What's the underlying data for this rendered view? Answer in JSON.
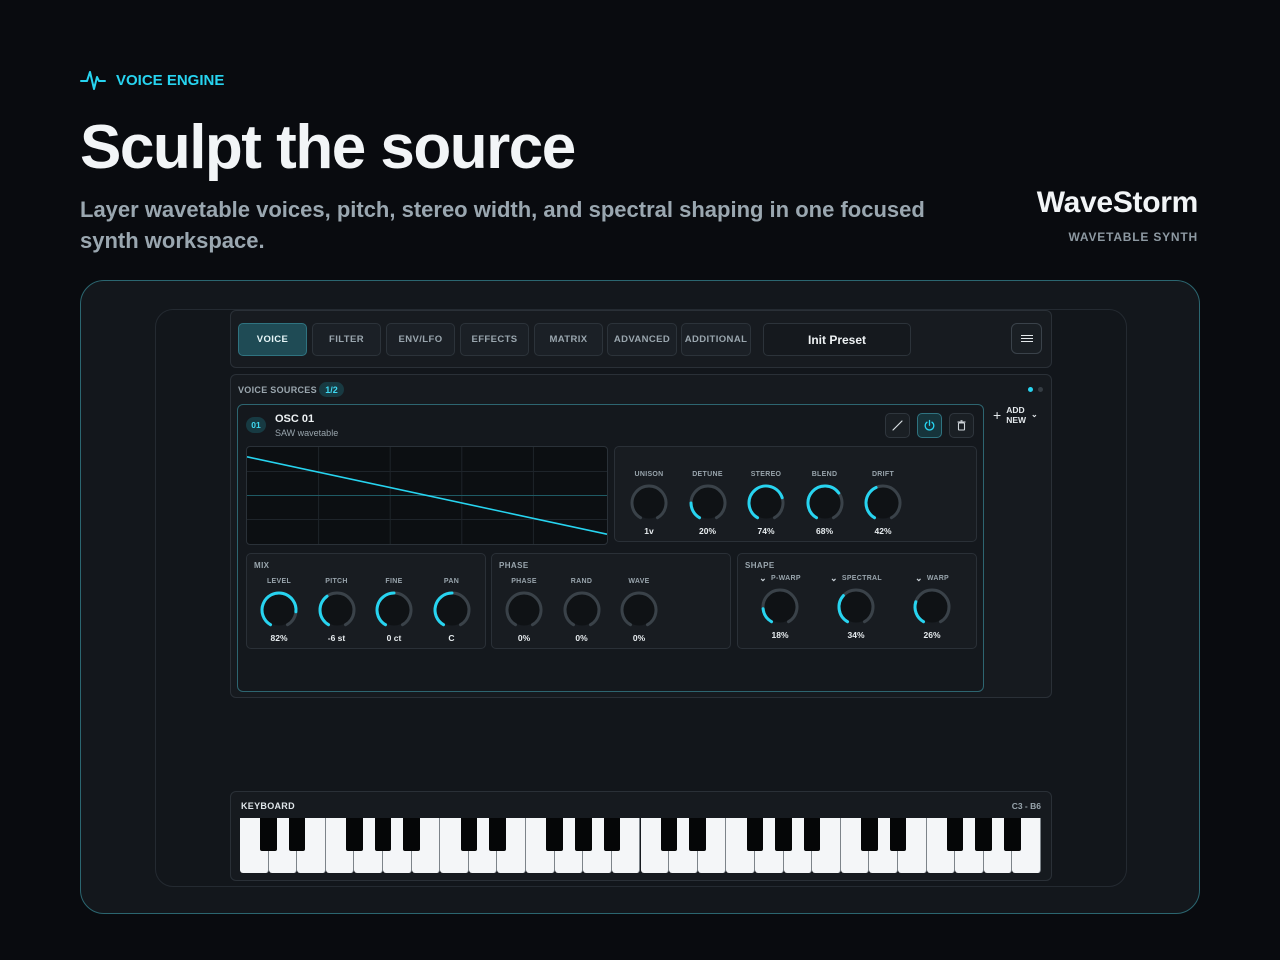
{
  "hero": {
    "eyebrow": "VOICE ENGINE",
    "title": "Sculpt the source",
    "subtitle": "Layer wavetable voices, pitch, stereo width, and spectral shaping in one focused synth workspace.",
    "brand_name": "WaveStorm",
    "brand_tag": "WAVETABLE SYNTH"
  },
  "colors": {
    "accent": "#27d4f0",
    "track": "#3a4249",
    "panel": "#161a1f",
    "border_accent": "#2d6570"
  },
  "tabs": [
    {
      "label": "VOICE",
      "active": true
    },
    {
      "label": "FILTER",
      "active": false
    },
    {
      "label": "ENV/LFO",
      "active": false
    },
    {
      "label": "EFFECTS",
      "active": false
    },
    {
      "label": "MATRIX",
      "active": false
    },
    {
      "label": "ADVANCED",
      "active": false
    },
    {
      "label": "ADDITIONAL",
      "active": false
    }
  ],
  "preset": {
    "name": "Init Preset"
  },
  "menu": {
    "icon": "hamburger-icon"
  },
  "voice_sources": {
    "title": "VOICE SOURCES",
    "count": "1/2",
    "add_line1": "ADD",
    "add_line2": "NEW"
  },
  "osc": {
    "number": "01",
    "name": "OSC 01",
    "type": "SAW wavetable",
    "actions": [
      "edit-icon",
      "power-icon",
      "trash-icon"
    ],
    "waveform": "saw",
    "voice_knobs": [
      {
        "label": "UNISON",
        "value": "1v",
        "level": 0.0
      },
      {
        "label": "DETUNE",
        "value": "20%",
        "level": 0.2
      },
      {
        "label": "STEREO",
        "value": "74%",
        "level": 0.74
      },
      {
        "label": "BLEND",
        "value": "68%",
        "level": 0.68
      },
      {
        "label": "DRIFT",
        "value": "42%",
        "level": 0.42
      }
    ],
    "sections": {
      "mix": {
        "title": "MIX",
        "knobs": [
          {
            "label": "LEVEL",
            "value": "82%",
            "level": 0.82
          },
          {
            "label": "PITCH",
            "value": "-6 st",
            "level": 0.38
          },
          {
            "label": "FINE",
            "value": "0 ct",
            "level": 0.5
          },
          {
            "label": "PAN",
            "value": "C",
            "level": 0.5
          }
        ]
      },
      "phase": {
        "title": "PHASE",
        "knobs": [
          {
            "label": "PHASE",
            "value": "0%",
            "level": 0.0
          },
          {
            "label": "RAND",
            "value": "0%",
            "level": 0.0
          },
          {
            "label": "WAVE",
            "value": "0%",
            "level": 0.0
          }
        ]
      },
      "shape": {
        "title": "SHAPE",
        "knobs": [
          {
            "label": "P-WARP",
            "value": "18%",
            "level": 0.18
          },
          {
            "label": "SPECTRAL",
            "value": "34%",
            "level": 0.34
          },
          {
            "label": "WARP",
            "value": "26%",
            "level": 0.26
          }
        ]
      }
    }
  },
  "keyboard": {
    "title": "KEYBOARD",
    "range": "C3 - B6"
  }
}
